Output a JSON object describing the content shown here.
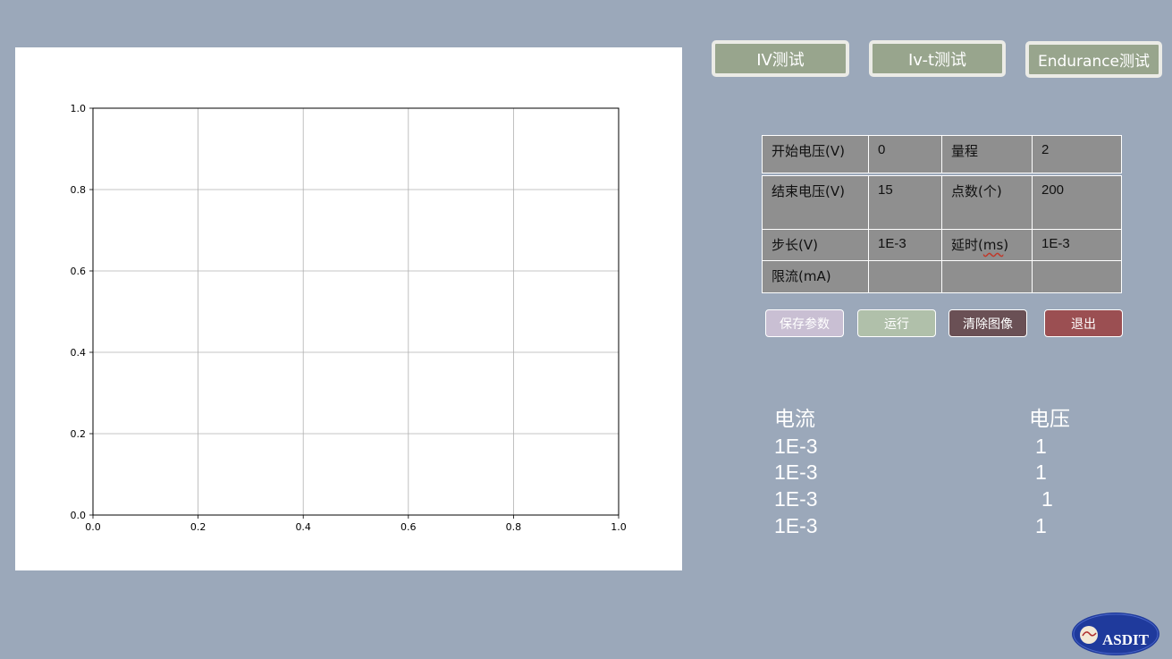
{
  "tabs": {
    "iv": "IV测试",
    "ivt": "Iv-t测试",
    "endurance": "Endurance测试"
  },
  "params": {
    "rows": [
      {
        "label1": "开始电压(V)",
        "value1": "0",
        "label2": "量程",
        "value2": "2"
      },
      {
        "label1": "结束电压(V)",
        "value1": "15",
        "label2": "点数(个)",
        "value2": "200"
      },
      {
        "label1": "步长(V)",
        "value1": "1E-3",
        "label2": "延时(ms)",
        "value2": "1E-3"
      },
      {
        "label1": "限流(mA)",
        "value1": "",
        "label2": "",
        "value2": ""
      }
    ]
  },
  "actions": {
    "save": "保存参数",
    "run": "运行",
    "clear": "清除图像",
    "exit": "退出"
  },
  "readout": {
    "current_header": "电流",
    "voltage_header": "电压",
    "rows": [
      {
        "current": "1E-3",
        "voltage": "1"
      },
      {
        "current": "1E-3",
        "voltage": "1"
      },
      {
        "current": "1E-3",
        "voltage": "1"
      },
      {
        "current": "1E-3",
        "voltage": "1"
      }
    ]
  },
  "logo": {
    "text": "ASDIT"
  },
  "chart_data": {
    "type": "line",
    "series": [],
    "xlim": [
      0.0,
      1.0
    ],
    "ylim": [
      0.0,
      1.0
    ],
    "x_ticks": [
      "0.0",
      "0.2",
      "0.4",
      "0.6",
      "0.8",
      "1.0"
    ],
    "y_ticks": [
      "0.0",
      "0.2",
      "0.4",
      "0.6",
      "0.8",
      "1.0"
    ],
    "grid": true,
    "colors": {
      "axis": "#000000",
      "grid": "#b0b0b0"
    }
  }
}
